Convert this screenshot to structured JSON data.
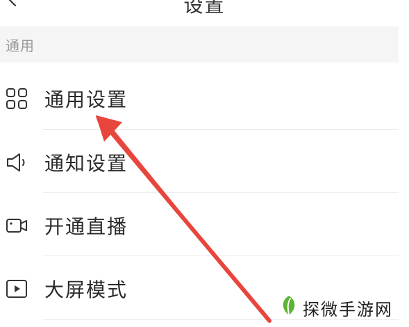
{
  "header": {
    "title": "设置"
  },
  "section": {
    "label": "通用"
  },
  "menu": {
    "items": [
      {
        "label": "通用设置",
        "icon": "grid-icon"
      },
      {
        "label": "通知设置",
        "icon": "speaker-icon"
      },
      {
        "label": "开通直播",
        "icon": "video-camera-icon"
      },
      {
        "label": "大屏模式",
        "icon": "play-screen-icon"
      }
    ]
  },
  "annotation": {
    "arrow_color": "#e8453c"
  },
  "watermark": {
    "text": "探微手游网",
    "logo_color": "#5cb531"
  }
}
